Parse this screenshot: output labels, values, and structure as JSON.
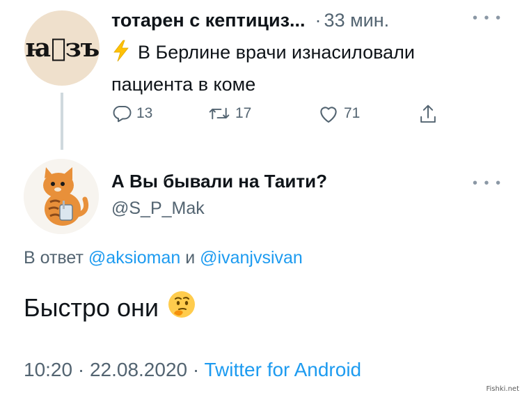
{
  "parent_tweet": {
    "avatar_text": "ꙗ҆зъ",
    "display_name": "тотарен с кептициз...",
    "separator": "·",
    "time": "33 мин.",
    "more_icon": "ellipsis-icon",
    "text": "В Берлине врачи изнасиловали пациента в коме",
    "actions": {
      "reply_count": "13",
      "retweet_count": "17",
      "like_count": "71"
    }
  },
  "reply_tweet": {
    "display_name": "А Вы бывали на Таити?",
    "handle": "@S_P_Mak",
    "reply_prefix": "В ответ",
    "mention1": "@aksioman",
    "conjunction": "и",
    "mention2": "@ivanjvsivan",
    "text": "Быстро они",
    "emoji": "thinking-face-emoji",
    "timestamp": "10:20 · 22.08.2020 · ",
    "source": "Twitter for Android"
  },
  "watermark": "Fishki.net",
  "colors": {
    "link": "#1d9bf0",
    "secondary_text": "#536471",
    "primary_text": "#0f1419",
    "bolt": "#ffc107"
  }
}
